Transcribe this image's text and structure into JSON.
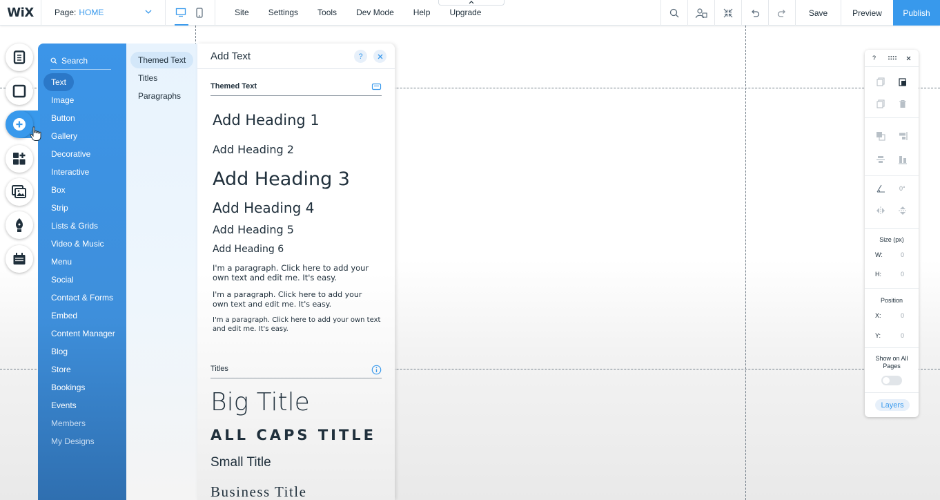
{
  "topbar": {
    "logo": "WiX",
    "page_label": "Page:",
    "page_value": "HOME",
    "menu": [
      "Site",
      "Settings",
      "Tools",
      "Dev Mode",
      "Help",
      "Upgrade"
    ],
    "save": "Save",
    "preview": "Preview",
    "publish": "Publish"
  },
  "add_panel": {
    "search_placeholder": "Search",
    "categories": [
      "Text",
      "Image",
      "Button",
      "Gallery",
      "Decorative",
      "Interactive",
      "Box",
      "Strip",
      "Lists & Grids",
      "Video & Music",
      "Menu",
      "Social",
      "Contact & Forms",
      "Embed",
      "Content Manager",
      "Blog",
      "Store",
      "Bookings",
      "Events",
      "Members",
      "My Designs"
    ],
    "active_category": "Text",
    "subcategories": [
      "Themed Text",
      "Titles",
      "Paragraphs"
    ],
    "active_subcategory": "Themed Text",
    "title": "Add Text",
    "help": "?",
    "themed_text_label": "Themed Text",
    "headings": [
      "Add Heading 1",
      "Add Heading 2",
      "Add Heading 3",
      "Add Heading 4",
      "Add Heading 5",
      "Add Heading 6"
    ],
    "paragraphs": [
      "I'm a paragraph. Click here to add your own text and edit me. It's easy.",
      "I'm a paragraph. Click here to add your own text and edit me. It's easy.",
      "I'm a paragraph. Click here to add your own text and edit me. It's easy."
    ],
    "titles_label": "Titles",
    "titles": [
      "Big Title",
      "ALL CAPS TITLE",
      "Small Title",
      "Business Title"
    ]
  },
  "inspector": {
    "help": "?",
    "rotation": "0°",
    "size_label": "Size (px)",
    "w_label": "W:",
    "w_value": "0",
    "h_label": "H:",
    "h_value": "0",
    "position_label": "Position",
    "x_label": "X:",
    "x_value": "0",
    "y_label": "Y:",
    "y_value": "0",
    "show_on_all_pages": "Show on All Pages",
    "layers": "Layers"
  },
  "colors": {
    "accent": "#3899ec",
    "panel_blue": "#3c95e8",
    "sub_panel": "#e8f3fd",
    "text": "#20303c"
  },
  "rail_icons": [
    "pages-icon",
    "background-icon",
    "add-icon",
    "apps-icon",
    "media-icon",
    "pen-icon",
    "business-icon"
  ]
}
